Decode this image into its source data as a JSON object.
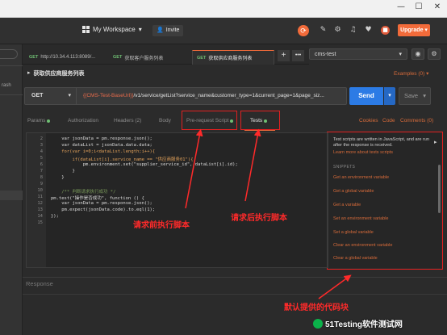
{
  "header": {
    "workspace_label": "My Workspace",
    "invite_label": "Invite",
    "upgrade_label": "Upgrade"
  },
  "sidebar": {
    "partial_text": "rash"
  },
  "tabs": [
    {
      "method": "GET",
      "label": "http://10.34.4.113:8089/..."
    },
    {
      "method": "GET",
      "label": "获取客户服务列表"
    },
    {
      "method": "GET",
      "label": "获取供应商服务列表"
    }
  ],
  "environment": {
    "selected": "cms-test"
  },
  "request": {
    "title": "获取供应商服务列表",
    "examples_label": "Examples (0)",
    "method": "GET",
    "url_var": "{{CMS-Test-BaseUrl}}",
    "url_rest": "/v1/service/getList?service_name&customer_type=1&current_page=1&page_siz...",
    "send_label": "Send",
    "save_label": "Save"
  },
  "subtabs": {
    "params": "Params",
    "authorization": "Authorization",
    "headers": "Headers (2)",
    "body": "Body",
    "prerequest": "Pre-request Script",
    "tests": "Tests",
    "cookies": "Cookies",
    "code": "Code",
    "comments": "Comments (0)"
  },
  "editor": {
    "line_numbers": [
      "2",
      "3",
      "4",
      "5",
      "6",
      "7",
      "8",
      "9",
      "10",
      "11",
      "12",
      "13",
      "14",
      "15"
    ],
    "lines": [
      "    var jsonData = pm.response.json();",
      "    var dataList = jsonData.data.data;",
      "    for(var i=0;i<dataList.length;i++){",
      "        if(dataList[i].service_name == \"供应商服务01\"){",
      "            pm.environment.set(\"supplier_service_id\", dataList[i].id);",
      "        }",
      "    }",
      "",
      "    /** 判断请求执行成功 */",
      "pm.test(\"操作是否成功\", function () {",
      "    var jsonData = pm.response.json();",
      "    pm.expect(jsonData.code).to.eql(1);",
      "});",
      ""
    ]
  },
  "snippets": {
    "info": "Test scripts are written in JavaScript, and are run after the response is received.",
    "learn_more": "Learn more about tests scripts",
    "heading": "SNIPPETS",
    "items": [
      "Get an environment variable",
      "Get a global variable",
      "Get a variable",
      "Set an environment variable",
      "Set a global variable",
      "Clear an environment variable",
      "Clear a global variable"
    ]
  },
  "response": {
    "label": "Response"
  },
  "annotations": {
    "prerequest": "请求前执行脚本",
    "tests": "请求后执行脚本",
    "snippets": "默认提供的代码块"
  },
  "watermark": {
    "text": "51Testing软件测试网"
  },
  "colors": {
    "accent": "#f26b3a",
    "send_blue": "#2c7be5",
    "annotation_red": "#ff2a2a",
    "status_green": "#6fbf73"
  }
}
